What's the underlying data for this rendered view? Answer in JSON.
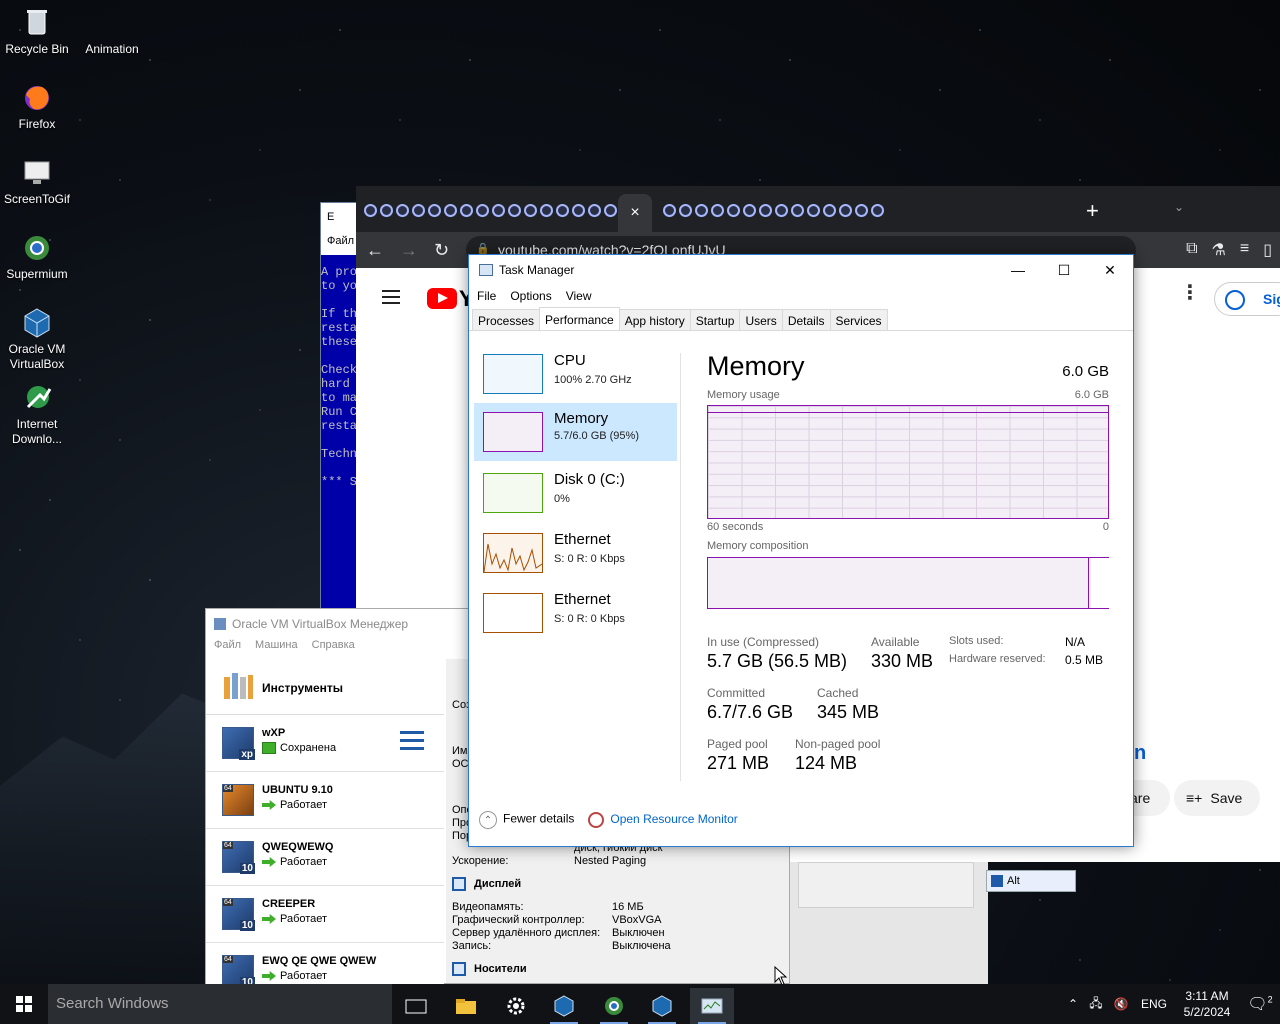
{
  "desktop": {
    "icons": [
      {
        "label": "Recycle Bin",
        "icon": "recycle-bin-icon"
      },
      {
        "label": "Animation",
        "icon": "folder-icon"
      },
      {
        "label": "Firefox",
        "icon": "firefox-icon"
      },
      {
        "label": "ScreenToGif",
        "icon": "screentogif-icon"
      },
      {
        "label": "Supermium",
        "icon": "supermium-icon"
      },
      {
        "label": "Oracle VM VirtualBox",
        "icon": "virtualbox-icon"
      },
      {
        "label": "Internet Downlo...",
        "icon": "idm-icon"
      }
    ]
  },
  "console": {
    "title": "E",
    "menu": "Файл",
    "lines": [
      "A pro",
      "to yo",
      "",
      "If th",
      "resta",
      "these",
      "",
      "Check",
      "hard",
      "to ma",
      "Run C",
      "resta",
      "",
      "Techn",
      "",
      "*** S"
    ]
  },
  "chrome": {
    "url": "youtube.com/watch?v=2fOLonfUJvU",
    "close_tab": "×",
    "new_tab": "+",
    "sign_in": "Sign",
    "title_fragment": "n",
    "share_fragment": "are",
    "save_label": "Save"
  },
  "task_manager": {
    "title": "Task Manager",
    "menu": [
      "File",
      "Options",
      "View"
    ],
    "tabs": [
      "Processes",
      "Performance",
      "App history",
      "Startup",
      "Users",
      "Details",
      "Services"
    ],
    "active_tab": "Performance",
    "sidebar": [
      {
        "name": "CPU",
        "sub": "100%  2.70 GHz",
        "color": "#117dbb"
      },
      {
        "name": "Memory",
        "sub": "5.7/6.0 GB (95%)",
        "color": "#8b12ae"
      },
      {
        "name": "Disk 0 (C:)",
        "sub": "0%",
        "color": "#4da60c"
      },
      {
        "name": "Ethernet",
        "sub": "S: 0  R: 0 Kbps",
        "color": "#a74f01"
      },
      {
        "name": "Ethernet",
        "sub": "S: 0  R: 0 Kbps",
        "color": "#a74f01"
      }
    ],
    "memory": {
      "heading": "Memory",
      "total": "6.0 GB",
      "usage_label": "Memory usage",
      "usage_max": "6.0 GB",
      "seconds_label": "60 seconds",
      "zero": "0",
      "composition_label": "Memory composition",
      "in_use_label": "In use (Compressed)",
      "in_use_value": "5.7 GB (56.5 MB)",
      "available_label": "Available",
      "available_value": "330 MB",
      "slots_label": "Slots used:",
      "slots_value": "N/A",
      "hw_reserved_label": "Hardware reserved:",
      "hw_reserved_value": "0.5 MB",
      "committed_label": "Committed",
      "committed_value": "6.7/7.6 GB",
      "cached_label": "Cached",
      "cached_value": "345 MB",
      "paged_label": "Paged pool",
      "paged_value": "271 MB",
      "nonpaged_label": "Non-paged pool",
      "nonpaged_value": "124 MB",
      "usage_fraction": 0.95
    },
    "footer": {
      "fewer_details": "Fewer details",
      "resource_monitor": "Open Resource Monitor"
    }
  },
  "virtualbox": {
    "title": "Oracle VM VirtualBox Менеджер",
    "menu": [
      "Файл",
      "Машина",
      "Справка"
    ],
    "tools_label": "Инструменты",
    "vms": [
      {
        "name": "wXP",
        "state": "Сохранена",
        "badge": "xp"
      },
      {
        "name": "UBUNTU 9.10",
        "state": "Работает",
        "badge": ""
      },
      {
        "name": "QWEQWEWQ",
        "state": "Работает",
        "badge": "10"
      },
      {
        "name": "CREEPER",
        "state": "Работает",
        "badge": "10"
      },
      {
        "name": "EWQ QE QWE QWEW",
        "state": "Работает",
        "badge": "10"
      }
    ],
    "details": {
      "frag_create": "Соз",
      "frag_name": "Имя",
      "frag_os": "ОС",
      "frag_one": "Опе",
      "frag_pro": "Про",
      "frag_por": "Пор",
      "disk_frag": "диск, гибкий диск",
      "accel_label": "Ускорение:",
      "accel_value": "Nested Paging",
      "display_head": "Дисплей",
      "vram_label": "Видеопамять:",
      "vram_value": "16 МБ",
      "gfx_label": "Графический контроллер:",
      "gfx_value": "VBoxVGA",
      "rdp_label": "Сервер удалённого дисплея:",
      "rdp_value": "Выключен",
      "rec_label": "Запись:",
      "rec_value": "Выключена",
      "storage_head": "Носители"
    }
  },
  "alt_chip": "Alt",
  "taskbar": {
    "search_placeholder": "Search Windows",
    "lang": "ENG",
    "time": "3:11 AM",
    "date": "5/2/2024",
    "notifications": "2"
  }
}
